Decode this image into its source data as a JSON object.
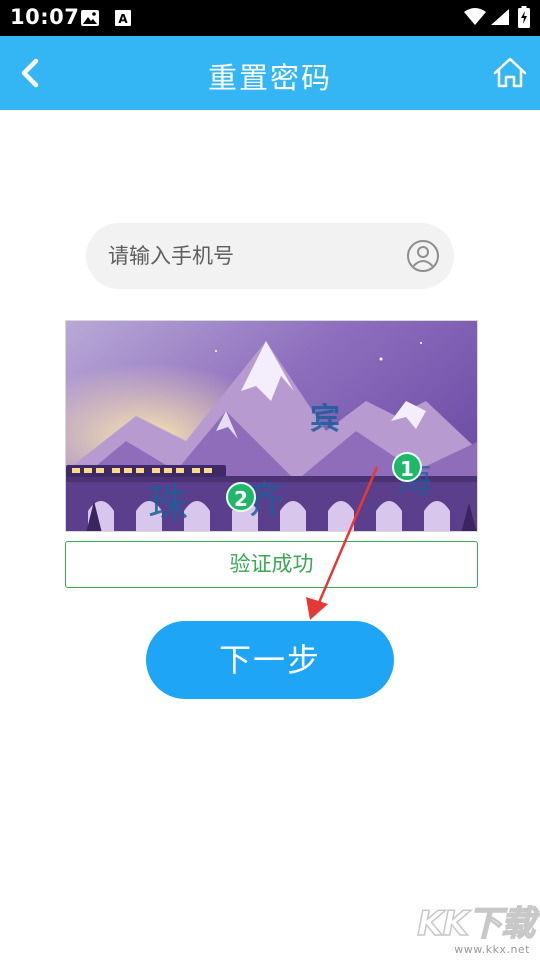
{
  "status_bar": {
    "time": "10:07"
  },
  "header": {
    "title": "重置密码"
  },
  "phone": {
    "placeholder": "请输入手机号"
  },
  "captcha": {
    "characters": [
      "宾",
      "珠",
      "齐",
      "海"
    ],
    "markers": [
      "1",
      "2"
    ]
  },
  "verify": {
    "text": "验证成功"
  },
  "next_button": {
    "label": "下一步"
  },
  "watermark": {
    "logo": "KK下载",
    "url": "www.kkx.net"
  },
  "colors": {
    "app_bar": "#34b6f5",
    "primary_button": "#1fa5f5",
    "success": "#3aa757",
    "marker": "#1fb86b",
    "annotation_arrow": "#e53935"
  }
}
